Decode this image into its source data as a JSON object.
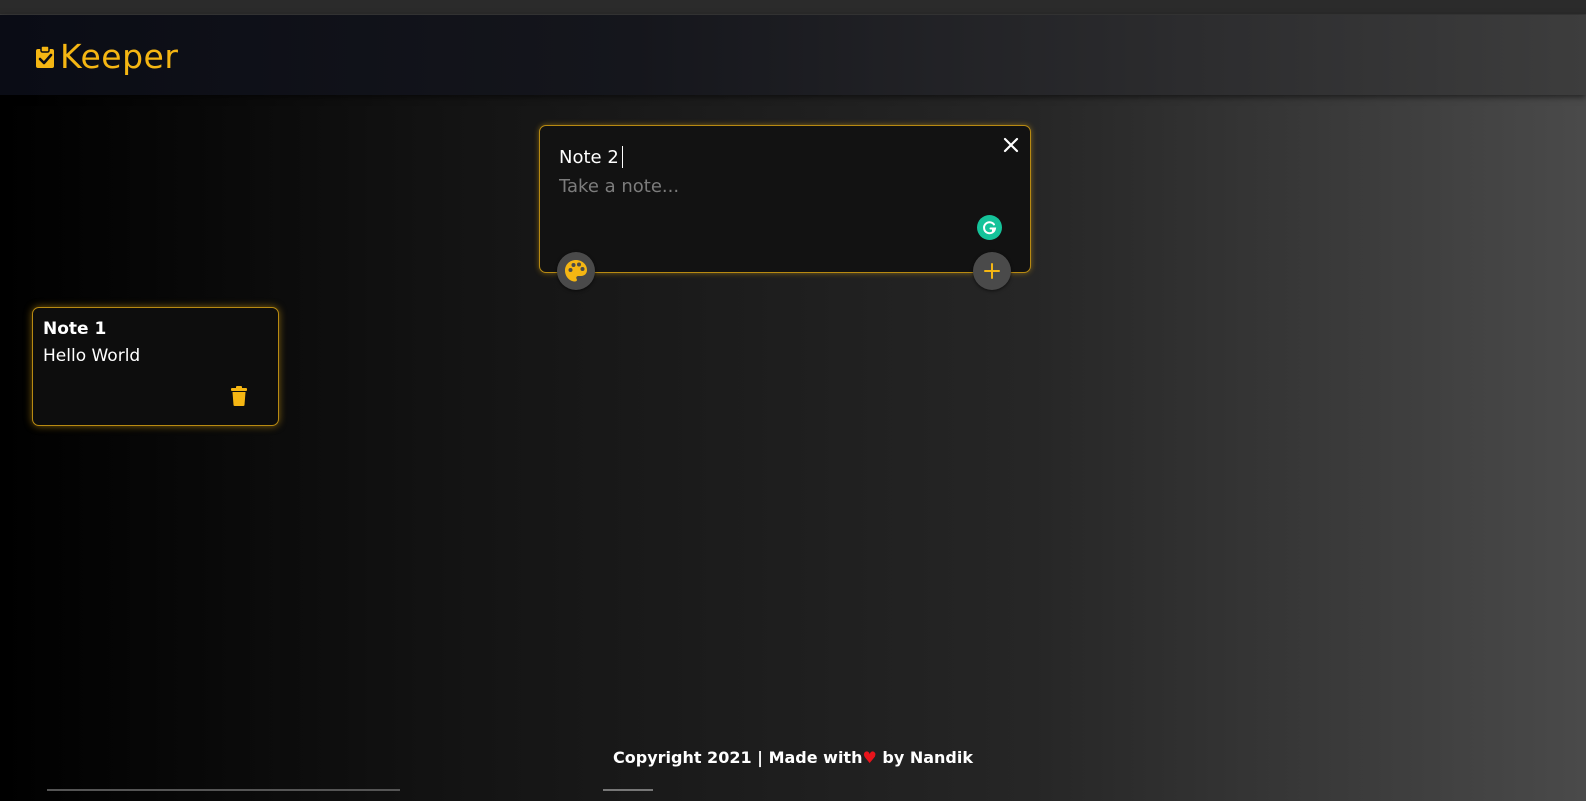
{
  "app": {
    "name": "Keeper",
    "accent_color": "#f5b613"
  },
  "create_note": {
    "title_value": "Note 2",
    "content_placeholder": "Take a note...",
    "icons": {
      "close": "close-icon",
      "palette": "palette-icon",
      "add": "plus-icon",
      "grammarly": "grammarly-icon"
    }
  },
  "notes": [
    {
      "title": "Note 1",
      "content": "Hello World",
      "delete_icon": "trash-icon"
    }
  ],
  "footer": {
    "prefix": "Copyright 2021 | Made with",
    "heart": "♥",
    "suffix": "by Nandik"
  }
}
